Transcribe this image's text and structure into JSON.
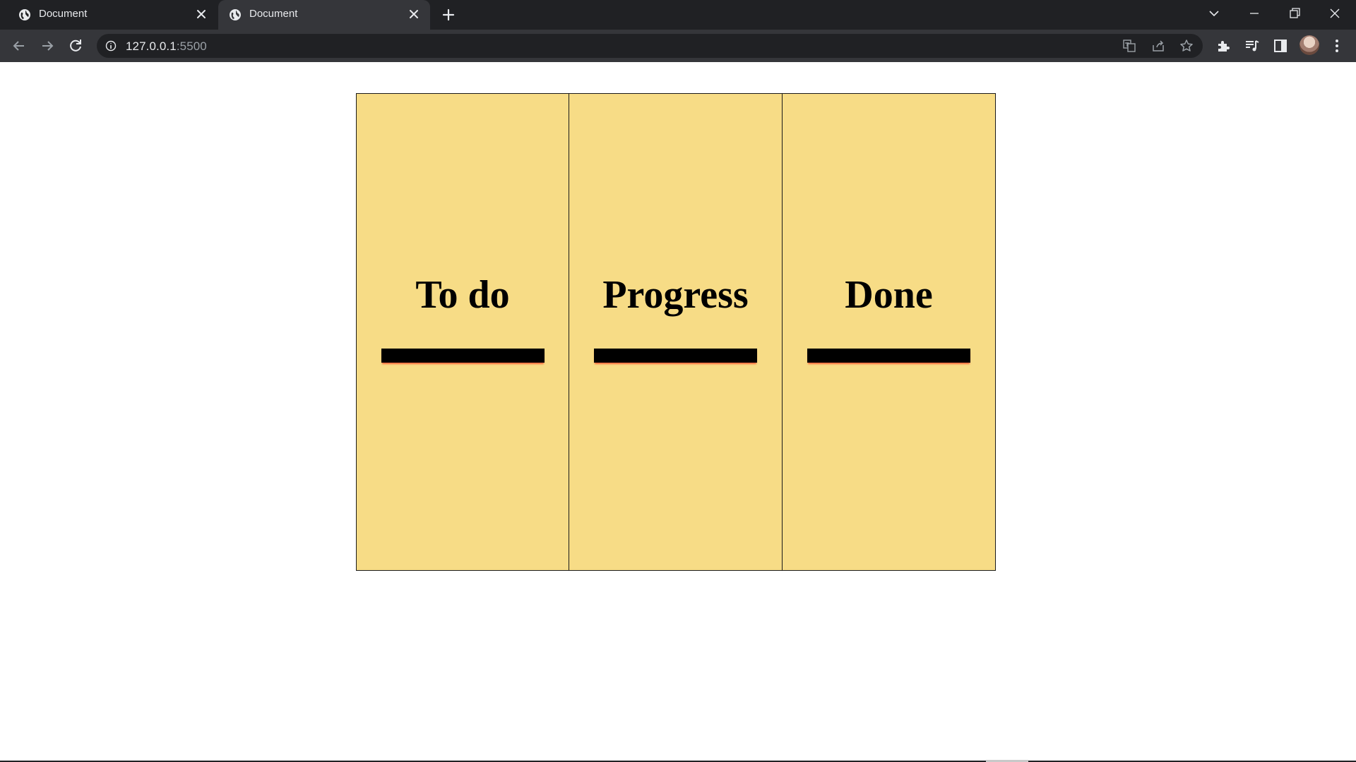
{
  "browser": {
    "tabs": [
      {
        "title": "Document",
        "active": false,
        "icon": "globe-icon"
      },
      {
        "title": "Document",
        "active": true,
        "icon": "globe-icon"
      }
    ],
    "url_host": "127.0.0.1",
    "url_port": ":5500",
    "colors": {
      "tabstrip": "#202124",
      "toolbar": "#35363a",
      "omnibox": "#202124"
    }
  },
  "board": {
    "columns": [
      {
        "heading": "To do"
      },
      {
        "heading": "Progress"
      },
      {
        "heading": "Done"
      }
    ],
    "colors": {
      "column_bg": "#f7dc86",
      "border": "#1a1a1a",
      "drop_bar": "#000000",
      "drop_shadow": "#ff6a3d"
    }
  }
}
